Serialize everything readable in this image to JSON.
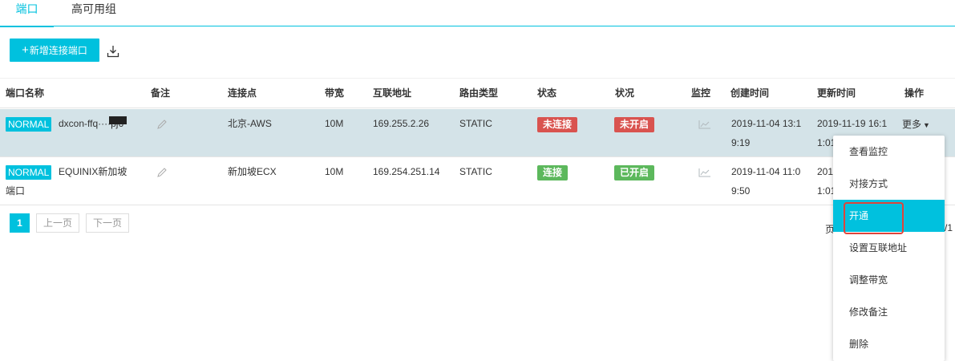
{
  "tabs": [
    {
      "label": "端口",
      "active": true
    },
    {
      "label": "高可用组",
      "active": false
    }
  ],
  "toolbar": {
    "add_label": "新增连接端口",
    "add_icon": "+",
    "download_icon": "download-icon"
  },
  "table": {
    "headers": [
      "端口名称",
      "备注",
      "连接点",
      "带宽",
      "互联地址",
      "路由类型",
      "状态",
      "状况",
      "监控",
      "创建时间",
      "更新时间",
      "操作"
    ],
    "rows": [
      {
        "tag": "NORMAL",
        "name": "dxcon-ffq····pj6",
        "name_line2": "",
        "access_point": "北京-AWS",
        "bandwidth": "10M",
        "address": "169.255.2.26",
        "route_type": "STATIC",
        "state": "未连接",
        "state_color": "#d9534f",
        "status": "未开启",
        "status_color": "#d9534f",
        "created_1": "2019-11-04 13:1",
        "created_2": "9:19",
        "updated_1": "2019-11-19 16:1",
        "updated_2": "1:01",
        "action": "更多"
      },
      {
        "tag": "NORMAL",
        "name": "EQUINIX新加坡",
        "name_line2": "端口",
        "access_point": "新加坡ECX",
        "bandwidth": "10M",
        "address": "169.254.251.14",
        "route_type": "STATIC",
        "state": "连接",
        "state_color": "#5cb85c",
        "status": "已开启",
        "status_color": "#5cb85c",
        "created_1": "2019-11-04 11:0",
        "created_2": "9:50",
        "updated_1": "201",
        "updated_2": "1:01"
      }
    ]
  },
  "pagination": {
    "current": "1",
    "prev": "上一页",
    "next": "下一页",
    "right_label": "页",
    "right_tail": "/1"
  },
  "dropdown": {
    "items": [
      "查看监控",
      "对接方式",
      "开通",
      "设置互联地址",
      "调整带宽",
      "修改备注",
      "删除"
    ],
    "active_index": 2
  },
  "colors": {
    "accent": "#00c1de",
    "danger": "#d9534f",
    "success": "#5cb85c",
    "selected_row": "#d4e3e8",
    "highlight": "#e0443a"
  }
}
